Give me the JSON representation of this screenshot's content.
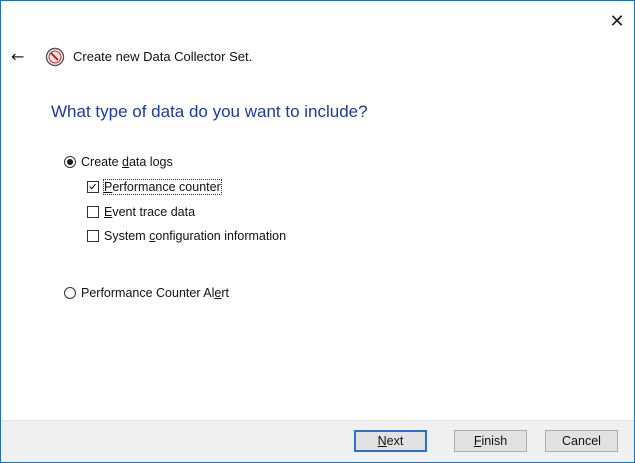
{
  "window": {
    "close_symbol": "✕",
    "back_symbol": "←",
    "title": "Create new Data Collector Set.",
    "title_icon": "performance-monitor-icon"
  },
  "page": {
    "heading": "What type of data do you want to include?"
  },
  "options": {
    "create_data_logs": {
      "prefix": "Create ",
      "accel": "d",
      "suffix": "ata logs",
      "selected": true
    },
    "performance_counter": {
      "prefix": "",
      "accel": "P",
      "suffix": "erformance counter",
      "checked": true
    },
    "event_trace": {
      "prefix": "",
      "accel": "E",
      "suffix": "vent trace data",
      "checked": false
    },
    "system_config": {
      "prefix": "System ",
      "accel": "c",
      "suffix": "onfiguration information",
      "checked": false
    },
    "counter_alert": {
      "prefix": "Performance Counter Al",
      "accel": "e",
      "suffix": "rt",
      "selected": false
    }
  },
  "buttons": {
    "next": {
      "accel": "N",
      "suffix": "ext"
    },
    "finish": {
      "accel": "F",
      "suffix": "inish"
    },
    "cancel": {
      "label": "Cancel"
    }
  },
  "colors": {
    "heading": "#1c3a9f",
    "window_border": "#1f6fbf",
    "default_button_border": "#2a6fd6",
    "footer_bg": "#f0f0f0"
  }
}
